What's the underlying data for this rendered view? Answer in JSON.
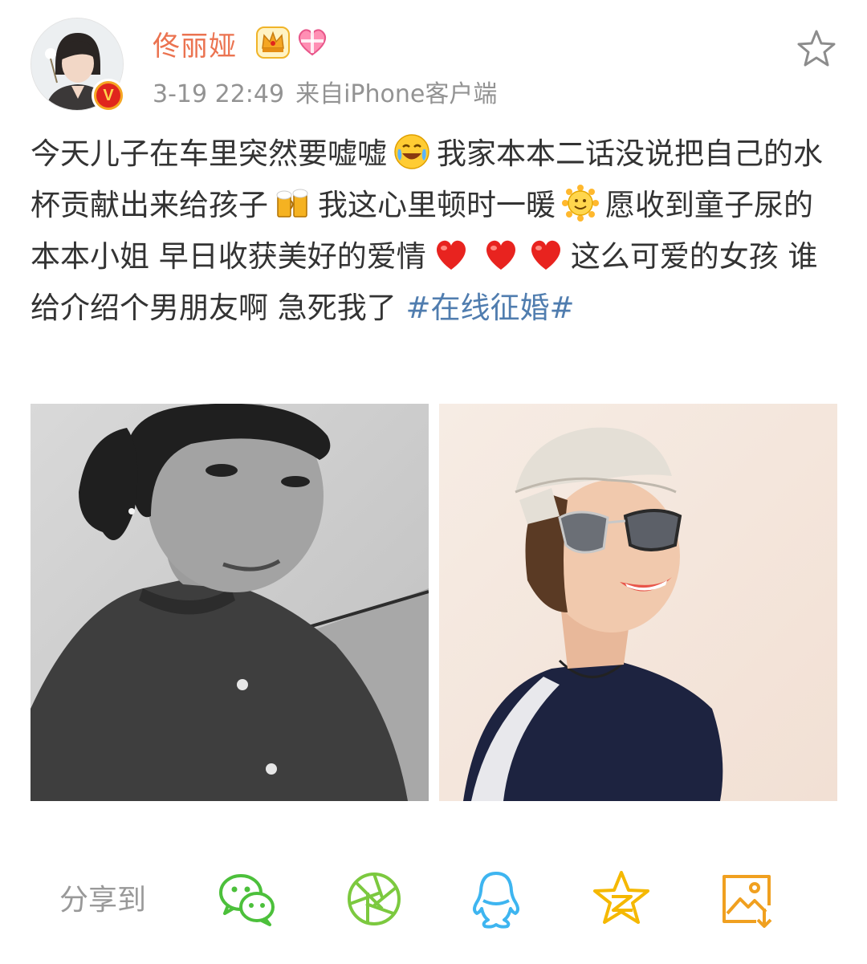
{
  "post": {
    "author": {
      "name": "佟丽娅",
      "badges": [
        "crown-icon",
        "heart-gift-icon"
      ],
      "verified": true
    },
    "timestamp": "3-19 22:49",
    "source": "来自iPhone客户端",
    "text": {
      "seg1": "今天儿子在车里突然要嘘嘘",
      "seg2": "我家本本二话没说把自己的水杯贡献出来给孩子",
      "seg3": "我这心里顿时一暖",
      "seg4": "愿收到童子尿的本本小姐 早日收获美好的爱情",
      "seg5": "这么可爱的女孩 谁给介绍个男朋友啊 急死我了",
      "hashtag": "#在线征婚#"
    },
    "emoticons": [
      "laugh-cry-icon",
      "beer-icon",
      "sun-smile-icon",
      "red-heart-icon",
      "red-heart-icon",
      "red-heart-icon"
    ],
    "photos": [
      "photo-bw-selfie",
      "photo-cap-sunglasses"
    ]
  },
  "share": {
    "label": "分享到",
    "targets": [
      "wechat-icon",
      "moments-icon",
      "qq-icon",
      "qzone-icon",
      "save-image-icon"
    ]
  },
  "colors": {
    "username": "#eb7350",
    "meta": "#939393",
    "text": "#333333",
    "hashtag": "#507daf",
    "wechat": "#4cc03b",
    "moments": "#7cc93f",
    "qq": "#3eb5f0",
    "qzone": "#f5b800",
    "save": "#f0a020"
  }
}
